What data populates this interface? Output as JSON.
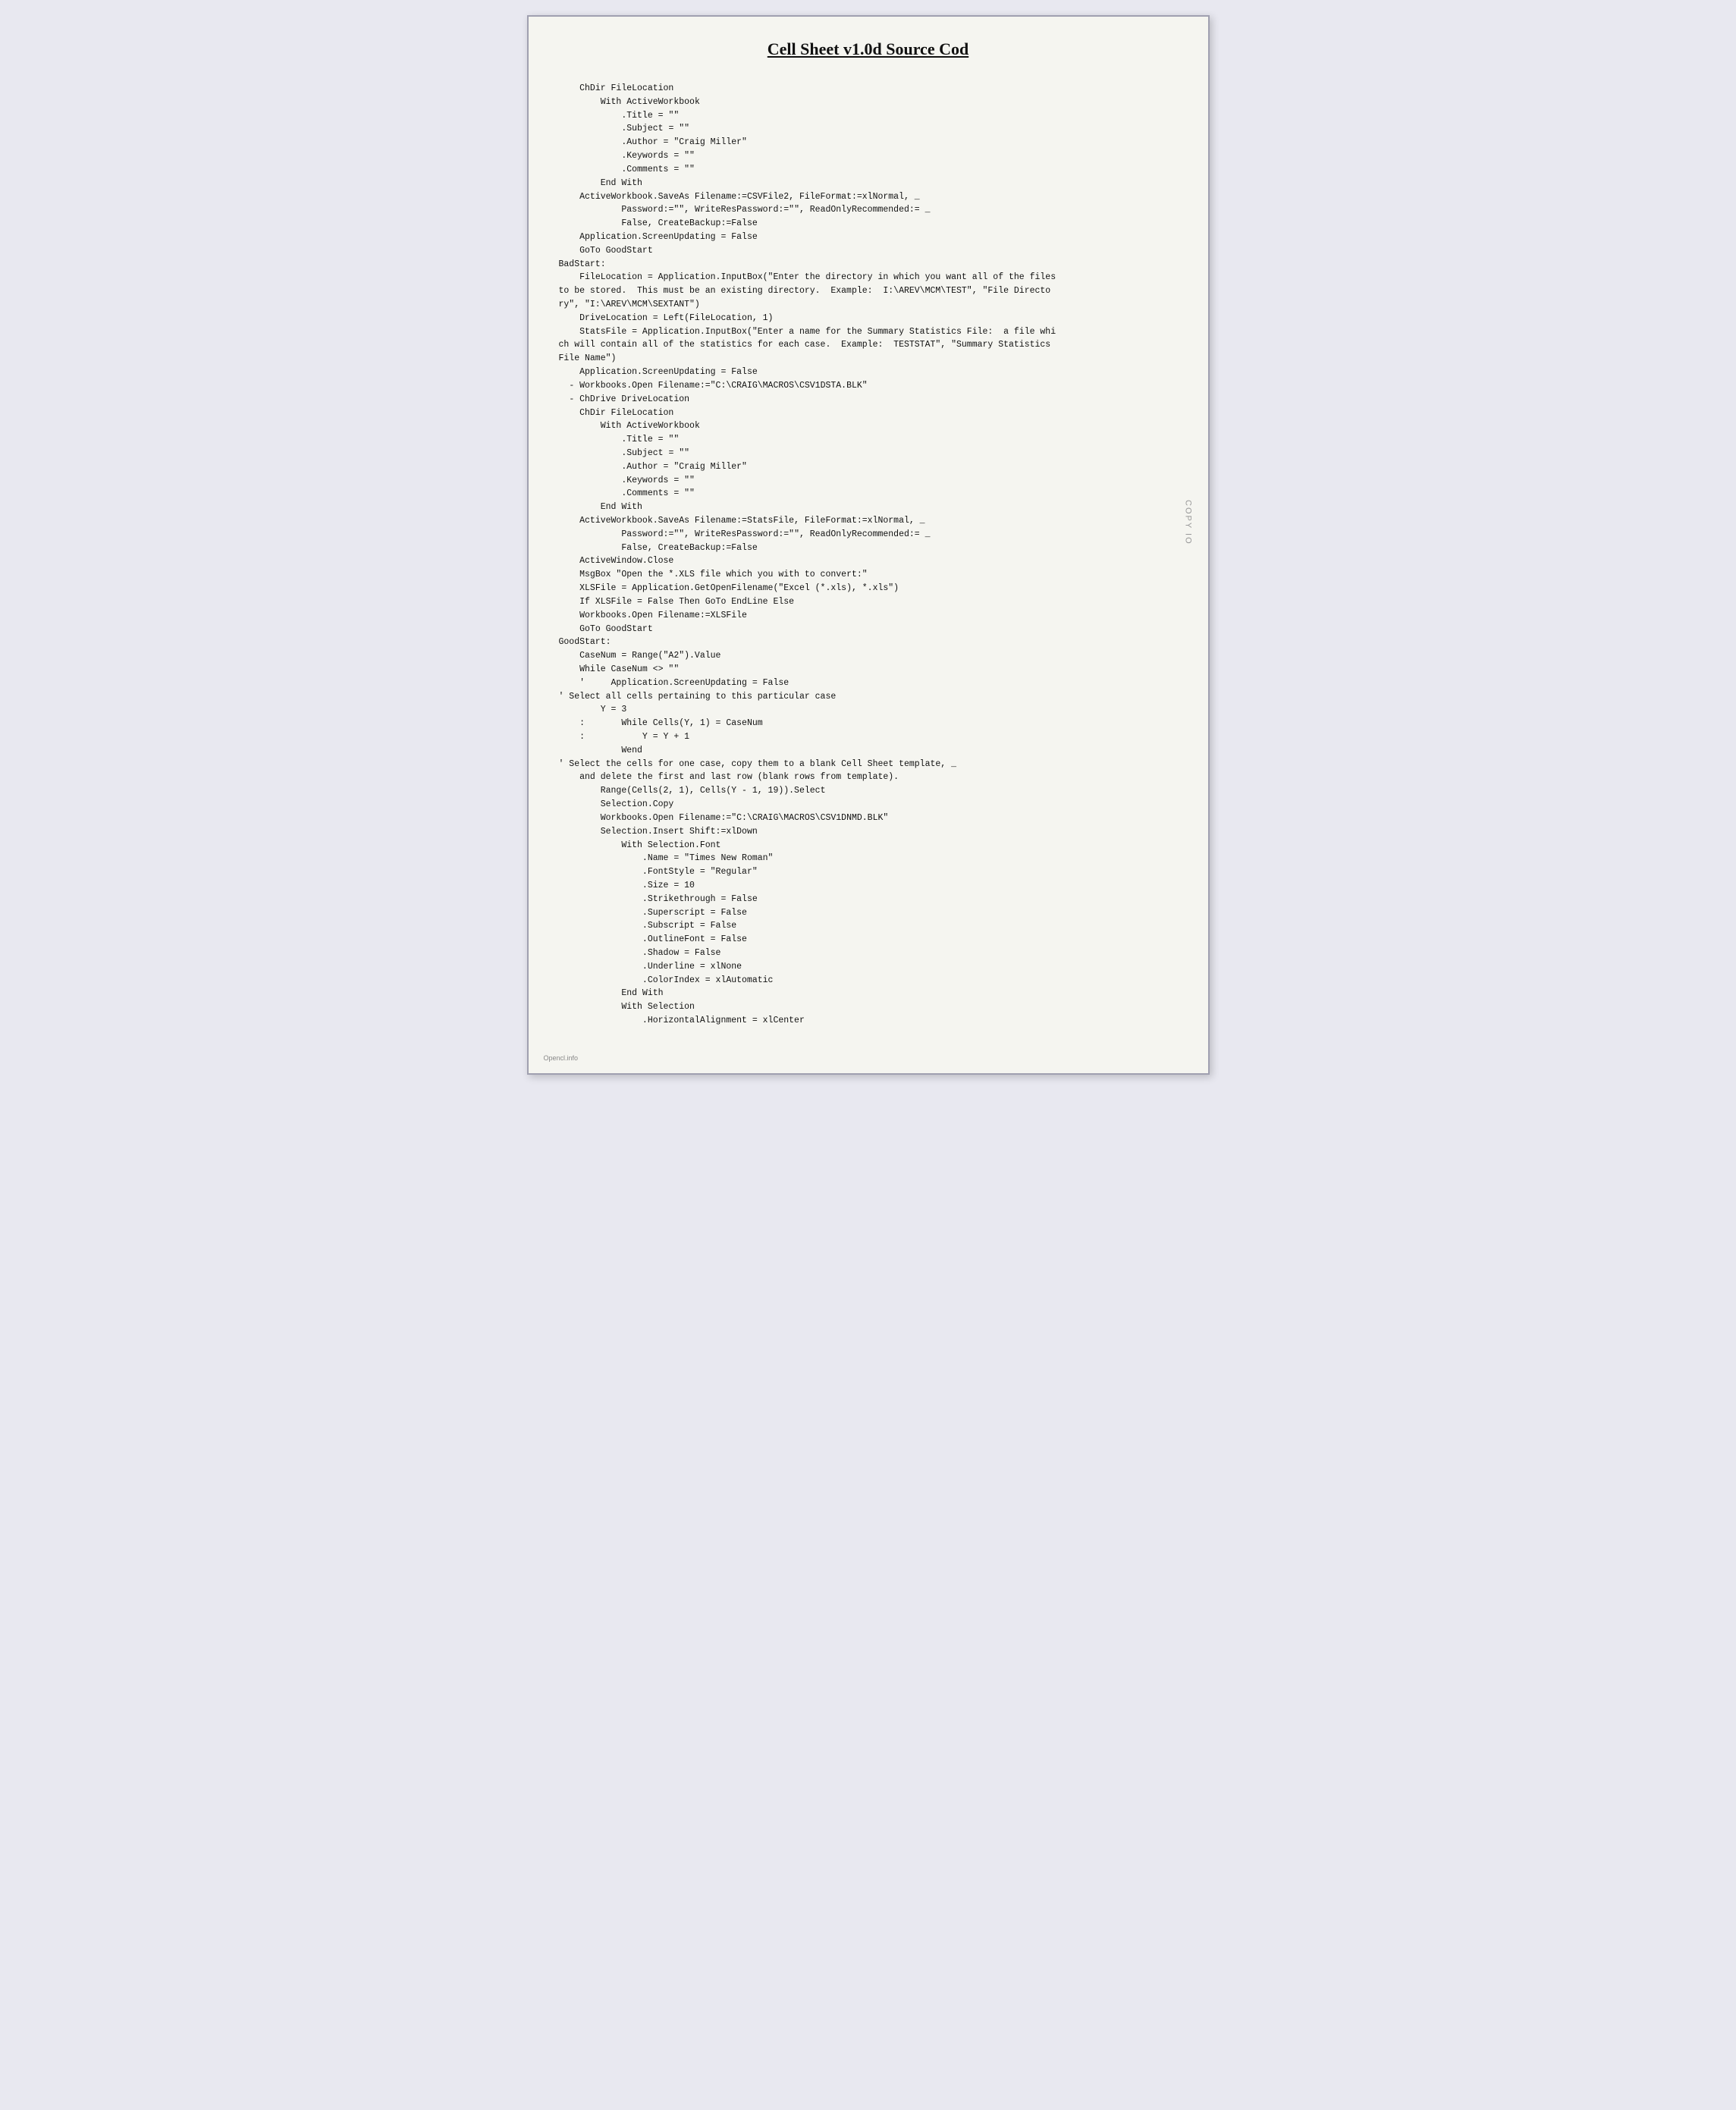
{
  "page": {
    "title": "Cell Sheet v1.0d Source Cod",
    "watermark_left": "Opencl.info",
    "watermark_right": "COPY IO"
  },
  "code": {
    "content": "    ChDir FileLocation\n        With ActiveWorkbook\n            .Title = \"\"\n            .Subject = \"\"\n            .Author = \"Craig Miller\"\n            .Keywords = \"\"\n            .Comments = \"\"\n        End With\n    ActiveWorkbook.SaveAs Filename:=CSVFile2, FileFormat:=xlNormal, _\n            Password:=\"\", WriteResPassword:=\"\", ReadOnlyRecommended:= _\n            False, CreateBackup:=False\n    Application.ScreenUpdating = False\n    GoTo GoodStart\nBadStart:\n    FileLocation = Application.InputBox(\"Enter the directory in which you want all of the files\nto be stored.  This must be an existing directory.  Example:  I:\\AREV\\MCM\\TEST\", \"File Directo\nry\", \"I:\\AREV\\MCM\\SEXTANT\")\n    DriveLocation = Left(FileLocation, 1)\n    StatsFile = Application.InputBox(\"Enter a name for the Summary Statistics File:  a file whi\nch will contain all of the statistics for each case.  Example:  TESTSTAT\", \"Summary Statistics\nFile Name\")\n    Application.ScreenUpdating = False\n  - Workbooks.Open Filename:=\"C:\\CRAIG\\MACROS\\CSV1DSTA.BLK\"\n  - ChDrive DriveLocation\n    ChDir FileLocation\n        With ActiveWorkbook\n            .Title = \"\"\n            .Subject = \"\"\n            .Author = \"Craig Miller\"\n            .Keywords = \"\"\n            .Comments = \"\"\n        End With\n    ActiveWorkbook.SaveAs Filename:=StatsFile, FileFormat:=xlNormal, _\n            Password:=\"\", WriteResPassword:=\"\", ReadOnlyRecommended:= _\n            False, CreateBackup:=False\n    ActiveWindow.Close\n    MsgBox \"Open the *.XLS file which you with to convert:\"\n    XLSFile = Application.GetOpenFilename(\"Excel (*.xls), *.xls\")\n    If XLSFile = False Then GoTo EndLine Else\n    Workbooks.Open Filename:=XLSFile\n    GoTo GoodStart\nGoodStart:\n    CaseNum = Range(\"A2\").Value\n    While CaseNum <> \"\"\n    '     Application.ScreenUpdating = False\n' Select all cells pertaining to this particular case\n        Y = 3\n    :       While Cells(Y, 1) = CaseNum\n    :           Y = Y + 1\n            Wend\n' Select the cells for one case, copy them to a blank Cell Sheet template, _\n    and delete the first and last row (blank rows from template).\n        Range(Cells(2, 1), Cells(Y - 1, 19)).Select\n        Selection.Copy\n        Workbooks.Open Filename:=\"C:\\CRAIG\\MACROS\\CSV1DNMD.BLK\"\n        Selection.Insert Shift:=xlDown\n            With Selection.Font\n                .Name = \"Times New Roman\"\n                .FontStyle = \"Regular\"\n                .Size = 10\n                .Strikethrough = False\n                .Superscript = False\n                .Subscript = False\n                .OutlineFont = False\n                .Shadow = False\n                .Underline = xlNone\n                .ColorIndex = xlAutomatic\n            End With\n            With Selection\n                .HorizontalAlignment = xlCenter"
  }
}
